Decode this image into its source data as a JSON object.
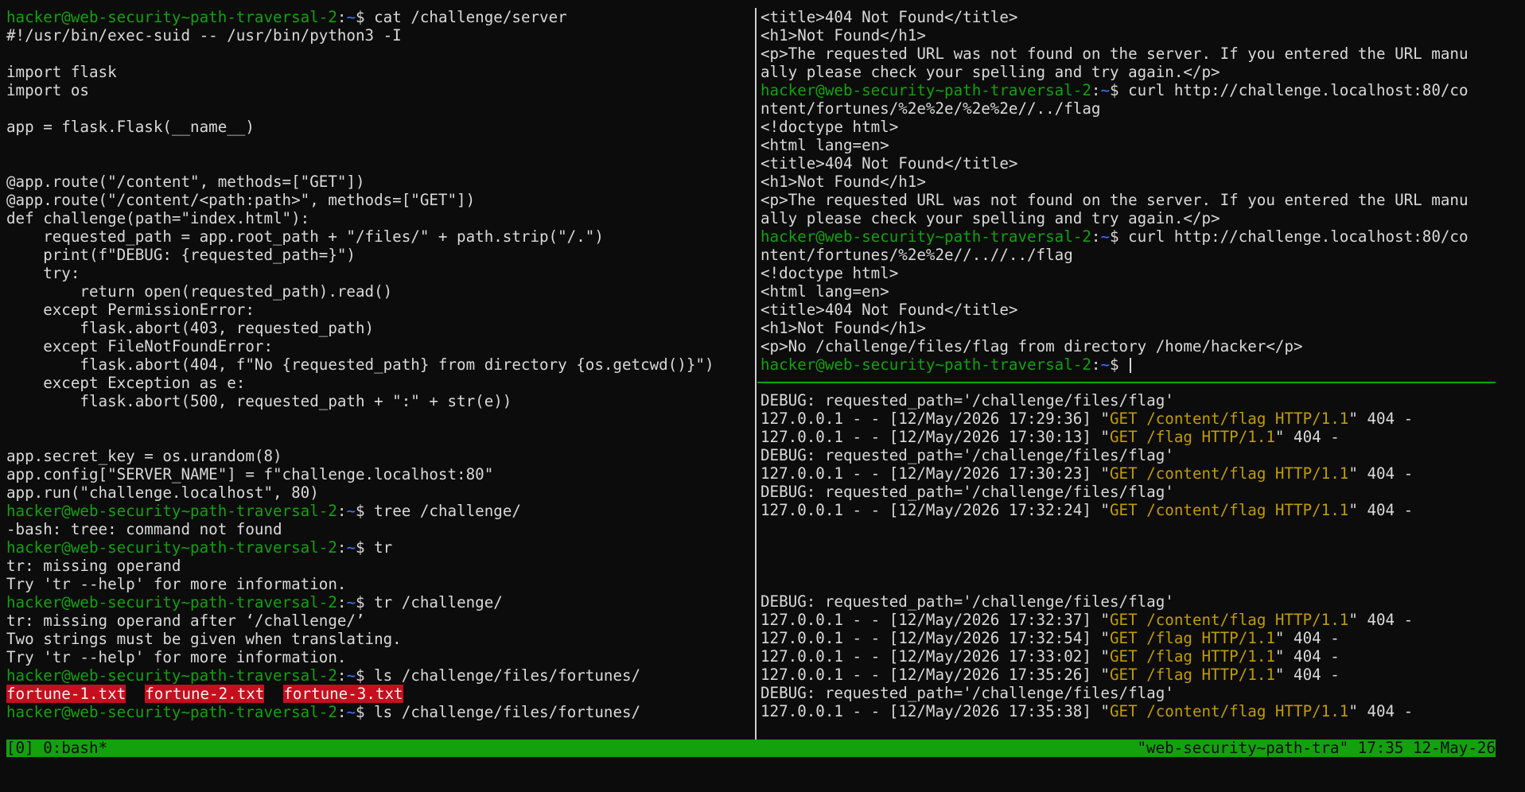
{
  "prompt": {
    "user": "hacker@web-security~path-traversal-2",
    "sep": ":",
    "dir": "~",
    "sym": "$ "
  },
  "left_pane": {
    "cmd_cat": "cat /challenge/server",
    "code": [
      "#!/usr/bin/exec-suid -- /usr/bin/python3 -I",
      "",
      "import flask",
      "import os",
      "",
      "app = flask.Flask(__name__)",
      "",
      "",
      "@app.route(\"/content\", methods=[\"GET\"])",
      "@app.route(\"/content/<path:path>\", methods=[\"GET\"])",
      "def challenge(path=\"index.html\"):",
      "    requested_path = app.root_path + \"/files/\" + path.strip(\"/.\")",
      "    print(f\"DEBUG: {requested_path=}\")",
      "    try:",
      "        return open(requested_path).read()",
      "    except PermissionError:",
      "        flask.abort(403, requested_path)",
      "    except FileNotFoundError:",
      "        flask.abort(404, f\"No {requested_path} from directory {os.getcwd()}\")",
      "    except Exception as e:",
      "        flask.abort(500, requested_path + \":\" + str(e))",
      "",
      "",
      "app.secret_key = os.urandom(8)",
      "app.config[\"SERVER_NAME\"] = f\"challenge.localhost:80\"",
      "app.run(\"challenge.localhost\", 80)"
    ],
    "cmd_tree": "tree /challenge/",
    "out_tree": "-bash: tree: command not found",
    "cmd_tr": "tr",
    "out_tr": [
      "tr: missing operand",
      "Try 'tr --help' for more information."
    ],
    "cmd_tr2": "tr /challenge/",
    "out_tr2": [
      "tr: missing operand after ‘/challenge/’",
      "Two strings must be given when translating.",
      "Try 'tr --help' for more information."
    ],
    "cmd_ls": "ls /challenge/files/fortunes/",
    "files": [
      "fortune-1.txt",
      "fortune-2.txt",
      "fortune-3.txt"
    ],
    "cmd_ls2": "ls /challenge/files/fortunes/"
  },
  "right_top": {
    "out1": [
      "<title>404 Not Found</title>",
      "<h1>Not Found</h1>",
      "<p>The requested URL was not found on the server. If you entered the URL manu",
      "ally please check your spelling and try again.</p>"
    ],
    "cmd1_a": "curl http://challenge.localhost:80/co",
    "cmd1_b": "ntent/fortunes/%2e%2e/%2e%2e//../flag",
    "out2": [
      "<!doctype html>",
      "<html lang=en>",
      "<title>404 Not Found</title>",
      "<h1>Not Found</h1>",
      "<p>The requested URL was not found on the server. If you entered the URL manu",
      "ally please check your spelling and try again.</p>"
    ],
    "cmd2_a": "curl http://challenge.localhost:80/co",
    "cmd2_b": "ntent/fortunes/%2e%2e//..//../flag",
    "out3": [
      "<!doctype html>",
      "<html lang=en>",
      "<title>404 Not Found</title>",
      "<h1>Not Found</h1>",
      "<p>No /challenge/files/flag from directory /home/hacker</p>"
    ]
  },
  "right_bottom": {
    "lines": [
      {
        "text": "DEBUG: requested_path='/challenge/files/flag'"
      },
      {
        "pre": "127.0.0.1 - - [12/May/2026 17:29:36] \"",
        "req": "GET /content/flag HTTP/1.1",
        "post": "\" 404 -"
      },
      {
        "pre": "127.0.0.1 - - [12/May/2026 17:30:13] \"",
        "req": "GET /flag HTTP/1.1",
        "post": "\" 404 -"
      },
      {
        "text": "DEBUG: requested_path='/challenge/files/flag'"
      },
      {
        "pre": "127.0.0.1 - - [12/May/2026 17:30:23] \"",
        "req": "GET /content/flag HTTP/1.1",
        "post": "\" 404 -"
      },
      {
        "text": "DEBUG: requested_path='/challenge/files/flag'"
      },
      {
        "pre": "127.0.0.1 - - [12/May/2026 17:32:24] \"",
        "req": "GET /content/flag HTTP/1.1",
        "post": "\" 404 -"
      },
      {
        "text": ""
      },
      {
        "text": ""
      },
      {
        "text": ""
      },
      {
        "text": ""
      },
      {
        "text": "DEBUG: requested_path='/challenge/files/flag'"
      },
      {
        "pre": "127.0.0.1 - - [12/May/2026 17:32:37] \"",
        "req": "GET /content/flag HTTP/1.1",
        "post": "\" 404 -"
      },
      {
        "pre": "127.0.0.1 - - [12/May/2026 17:32:54] \"",
        "req": "GET /flag HTTP/1.1",
        "post": "\" 404 -"
      },
      {
        "pre": "127.0.0.1 - - [12/May/2026 17:33:02] \"",
        "req": "GET /flag HTTP/1.1",
        "post": "\" 404 -"
      },
      {
        "pre": "127.0.0.1 - - [12/May/2026 17:35:26] \"",
        "req": "GET /flag HTTP/1.1",
        "post": "\" 404 -"
      },
      {
        "text": "DEBUG: requested_path='/challenge/files/flag'"
      },
      {
        "pre": "127.0.0.1 - - [12/May/2026 17:35:38] \"",
        "req": "GET /content/flag HTTP/1.1",
        "post": "\" 404 -"
      }
    ]
  },
  "status_bar": {
    "left": "[0] 0:bash*",
    "right": "\"web-security~path-tra\" 17:35 12-May-26"
  },
  "colors": {
    "background": "#0c0c0c",
    "text": "#d9d9d9",
    "prompt_user": "#13a10e",
    "prompt_path": "#3b78ff",
    "request": "#c19c00",
    "file_highlight": "#c50f1f",
    "status_bar": "#13a10e"
  }
}
